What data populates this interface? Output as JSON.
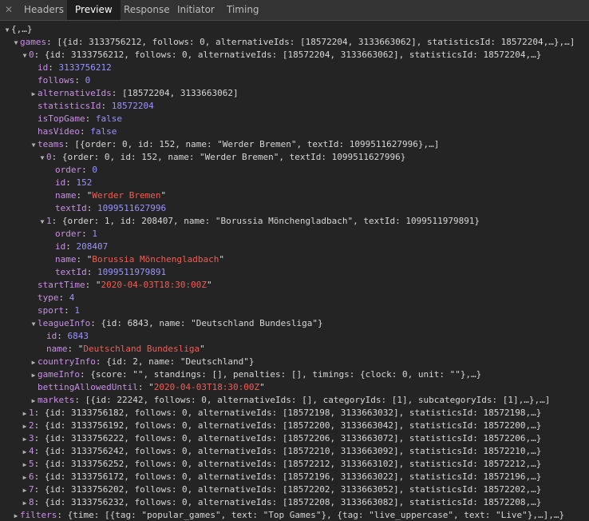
{
  "tabs": [
    "Headers",
    "Preview",
    "Response",
    "Initiator",
    "Timing"
  ],
  "active_tab": "Preview",
  "icons": {
    "close": "close-icon",
    "expanded": "triangle-down-icon",
    "collapsed": "triangle-right-icon"
  },
  "lines": [
    {
      "depth": 0,
      "tw": "down",
      "key": "",
      "preview": "{,…}"
    },
    {
      "depth": 1,
      "tw": "down",
      "key": "games",
      "preview": "[{id: 3133756212, follows: 0, alternativeIds: [18572204, 3133663062], statisticsId: 18572204,…},…]"
    },
    {
      "depth": 2,
      "tw": "down",
      "key": "0",
      "preview": "{id: 3133756212, follows: 0, alternativeIds: [18572204, 3133663062], statisticsId: 18572204,…}"
    },
    {
      "depth": 3,
      "tw": "",
      "key": "id",
      "value": "3133756212",
      "vtype": "n"
    },
    {
      "depth": 3,
      "tw": "",
      "key": "follows",
      "value": "0",
      "vtype": "n"
    },
    {
      "depth": 3,
      "tw": "right",
      "key": "alternativeIds",
      "preview": "[18572204, 3133663062]"
    },
    {
      "depth": 3,
      "tw": "",
      "key": "statisticsId",
      "value": "18572204",
      "vtype": "n"
    },
    {
      "depth": 3,
      "tw": "",
      "key": "isTopGame",
      "value": "false",
      "vtype": "b"
    },
    {
      "depth": 3,
      "tw": "",
      "key": "hasVideo",
      "value": "false",
      "vtype": "b"
    },
    {
      "depth": 3,
      "tw": "down",
      "key": "teams",
      "preview": "[{order: 0, id: 152, name: \"Werder Bremen\", textId: 1099511627996},…]"
    },
    {
      "depth": 4,
      "tw": "down",
      "key": "0",
      "preview": "{order: 0, id: 152, name: \"Werder Bremen\", textId: 1099511627996}"
    },
    {
      "depth": 5,
      "tw": "",
      "key": "order",
      "value": "0",
      "vtype": "n"
    },
    {
      "depth": 5,
      "tw": "",
      "key": "id",
      "value": "152",
      "vtype": "n"
    },
    {
      "depth": 5,
      "tw": "",
      "key": "name",
      "value": "Werder Bremen",
      "vtype": "s"
    },
    {
      "depth": 5,
      "tw": "",
      "key": "textId",
      "value": "1099511627996",
      "vtype": "n"
    },
    {
      "depth": 4,
      "tw": "down",
      "key": "1",
      "preview": "{order: 1, id: 208407, name: \"Borussia Mönchengladbach\", textId: 1099511979891}"
    },
    {
      "depth": 5,
      "tw": "",
      "key": "order",
      "value": "1",
      "vtype": "n"
    },
    {
      "depth": 5,
      "tw": "",
      "key": "id",
      "value": "208407",
      "vtype": "n"
    },
    {
      "depth": 5,
      "tw": "",
      "key": "name",
      "value": "Borussia Mönchengladbach",
      "vtype": "s"
    },
    {
      "depth": 5,
      "tw": "",
      "key": "textId",
      "value": "1099511979891",
      "vtype": "n"
    },
    {
      "depth": 3,
      "tw": "",
      "key": "startTime",
      "value": "2020-04-03T18:30:00Z",
      "vtype": "s"
    },
    {
      "depth": 3,
      "tw": "",
      "key": "type",
      "value": "4",
      "vtype": "n"
    },
    {
      "depth": 3,
      "tw": "",
      "key": "sport",
      "value": "1",
      "vtype": "n"
    },
    {
      "depth": 3,
      "tw": "down",
      "key": "leagueInfo",
      "preview": "{id: 6843, name: \"Deutschland Bundesliga\"}"
    },
    {
      "depth": 4,
      "tw": "",
      "key": "id",
      "value": "6843",
      "vtype": "n"
    },
    {
      "depth": 4,
      "tw": "",
      "key": "name",
      "value": "Deutschland Bundesliga",
      "vtype": "s"
    },
    {
      "depth": 3,
      "tw": "right",
      "key": "countryInfo",
      "preview": "{id: 2, name: \"Deutschland\"}"
    },
    {
      "depth": 3,
      "tw": "right",
      "key": "gameInfo",
      "preview": "{score: \"\", standings: [], penalties: [], timings: {clock: 0, unit: \"\"},…}"
    },
    {
      "depth": 3,
      "tw": "",
      "key": "bettingAllowedUntil",
      "value": "2020-04-03T18:30:00Z",
      "vtype": "s"
    },
    {
      "depth": 3,
      "tw": "right",
      "key": "markets",
      "preview": "[{id: 22242, follows: 0, alternativeIds: [], categoryIds: [1], subcategoryIds: [1],…},…]"
    },
    {
      "depth": 2,
      "tw": "right",
      "key": "1",
      "preview": "{id: 3133756182, follows: 0, alternativeIds: [18572198, 3133663032], statisticsId: 18572198,…}"
    },
    {
      "depth": 2,
      "tw": "right",
      "key": "2",
      "preview": "{id: 3133756192, follows: 0, alternativeIds: [18572200, 3133663042], statisticsId: 18572200,…}"
    },
    {
      "depth": 2,
      "tw": "right",
      "key": "3",
      "preview": "{id: 3133756222, follows: 0, alternativeIds: [18572206, 3133663072], statisticsId: 18572206,…}"
    },
    {
      "depth": 2,
      "tw": "right",
      "key": "4",
      "preview": "{id: 3133756242, follows: 0, alternativeIds: [18572210, 3133663092], statisticsId: 18572210,…}"
    },
    {
      "depth": 2,
      "tw": "right",
      "key": "5",
      "preview": "{id: 3133756252, follows: 0, alternativeIds: [18572212, 3133663102], statisticsId: 18572212,…}"
    },
    {
      "depth": 2,
      "tw": "right",
      "key": "6",
      "preview": "{id: 3133756172, follows: 0, alternativeIds: [18572196, 3133663022], statisticsId: 18572196,…}"
    },
    {
      "depth": 2,
      "tw": "right",
      "key": "7",
      "preview": "{id: 3133756202, follows: 0, alternativeIds: [18572202, 3133663052], statisticsId: 18572202,…}"
    },
    {
      "depth": 2,
      "tw": "right",
      "key": "8",
      "preview": "{id: 3133756232, follows: 0, alternativeIds: [18572208, 3133663082], statisticsId: 18572208,…}"
    },
    {
      "depth": 1,
      "tw": "right",
      "key": "filters",
      "preview": "{time: [{tag: \"popular_games\", text: \"Top Games\"}, {tag: \"live_uppercase\", text: \"Live\"},…],…}"
    }
  ]
}
